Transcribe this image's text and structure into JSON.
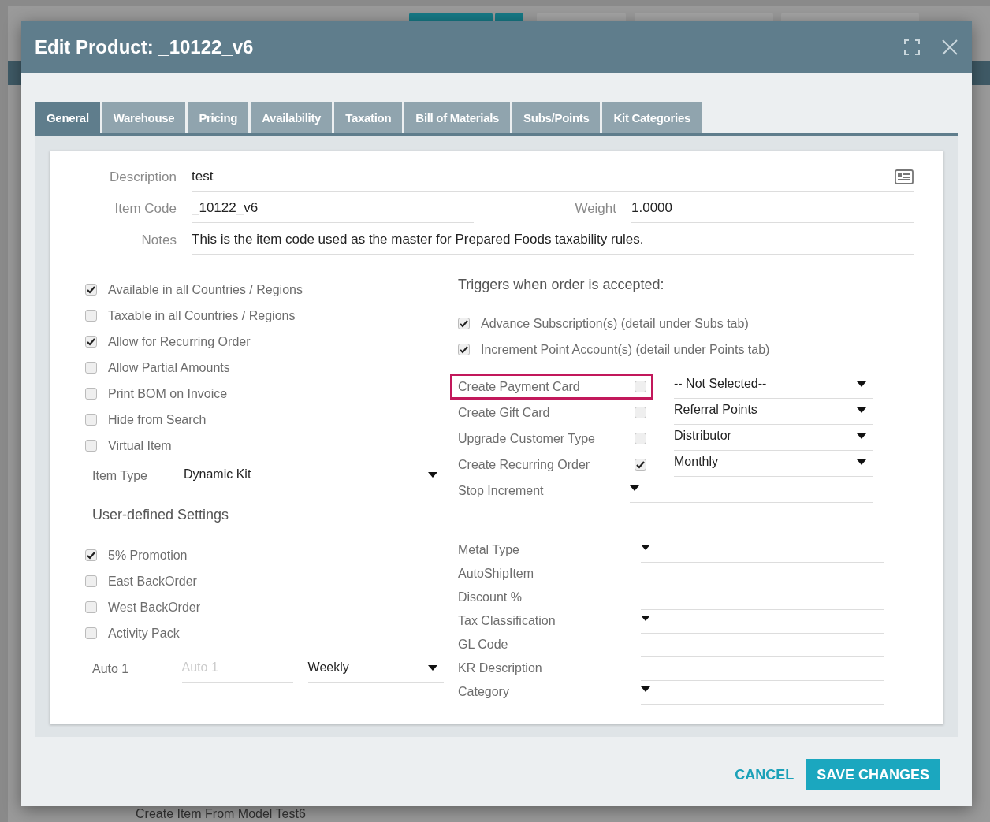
{
  "background": {
    "bottom_text": "Create Item From Model Test6"
  },
  "dialog": {
    "title": "Edit Product: _10122_v6"
  },
  "tabs": [
    {
      "label": "General",
      "selected": true
    },
    {
      "label": "Warehouse",
      "selected": false
    },
    {
      "label": "Pricing",
      "selected": false
    },
    {
      "label": "Availability",
      "selected": false
    },
    {
      "label": "Taxation",
      "selected": false
    },
    {
      "label": "Bill of Materials",
      "selected": false
    },
    {
      "label": "Subs/Points",
      "selected": false
    },
    {
      "label": "Kit Categories",
      "selected": false
    }
  ],
  "description": {
    "label": "Description",
    "value": "test"
  },
  "item_code": {
    "label": "Item Code",
    "value": "_10122_v6"
  },
  "weight": {
    "label": "Weight",
    "value": "1.0000"
  },
  "notes": {
    "label": "Notes",
    "value": "This is the item code used as the master for Prepared Foods taxability rules."
  },
  "options": [
    {
      "label": "Available in all Countries / Regions",
      "checked": true
    },
    {
      "label": "Taxable in all Countries / Regions",
      "checked": false
    },
    {
      "label": "Allow for Recurring Order",
      "checked": true
    },
    {
      "label": "Allow Partial Amounts",
      "checked": false
    },
    {
      "label": "Print BOM on Invoice",
      "checked": false
    },
    {
      "label": "Hide from Search",
      "checked": false
    },
    {
      "label": "Virtual Item",
      "checked": false
    }
  ],
  "item_type": {
    "label": "Item Type",
    "value": "Dynamic Kit"
  },
  "user_defined": {
    "title": "User-defined Settings",
    "options": [
      {
        "label": "5% Promotion",
        "checked": true
      },
      {
        "label": "East BackOrder",
        "checked": false
      },
      {
        "label": "West BackOrder",
        "checked": false
      },
      {
        "label": "Activity Pack",
        "checked": false
      }
    ],
    "auto": {
      "label": "Auto 1",
      "placeholder": "Auto 1",
      "frequency": "Weekly"
    }
  },
  "triggers": {
    "title": "Triggers when order is accepted:",
    "options": [
      {
        "label": "Advance Subscription(s) (detail under Subs tab)",
        "checked": true
      },
      {
        "label": "Increment Point Account(s) (detail under Points tab)",
        "checked": true
      }
    ],
    "actions": [
      {
        "kind": "check",
        "label": "Create Payment Card",
        "checked": false,
        "highlighted": true,
        "value": "-- Not Selected--"
      },
      {
        "kind": "check",
        "label": "Create Gift Card",
        "checked": false,
        "highlighted": false,
        "value": "Referral Points"
      },
      {
        "kind": "check",
        "label": "Upgrade Customer Type",
        "checked": false,
        "highlighted": false,
        "value": "Distributor"
      },
      {
        "kind": "check",
        "label": "Create Recurring Order",
        "checked": true,
        "highlighted": false,
        "value": "Monthly"
      },
      {
        "kind": "plain",
        "label": "Stop Increment",
        "highlighted": false
      }
    ]
  },
  "custom_fields": [
    {
      "label": "Metal Type",
      "kind": "select"
    },
    {
      "label": "AutoShipItem",
      "kind": "text"
    },
    {
      "label": "Discount %",
      "kind": "text"
    },
    {
      "label": "Tax Classification",
      "kind": "select"
    },
    {
      "label": "GL Code",
      "kind": "text"
    },
    {
      "label": "KR Description",
      "kind": "text"
    },
    {
      "label": "Category",
      "kind": "select"
    }
  ],
  "buttons": {
    "cancel": "CANCEL",
    "save": "SAVE CHANGES"
  }
}
